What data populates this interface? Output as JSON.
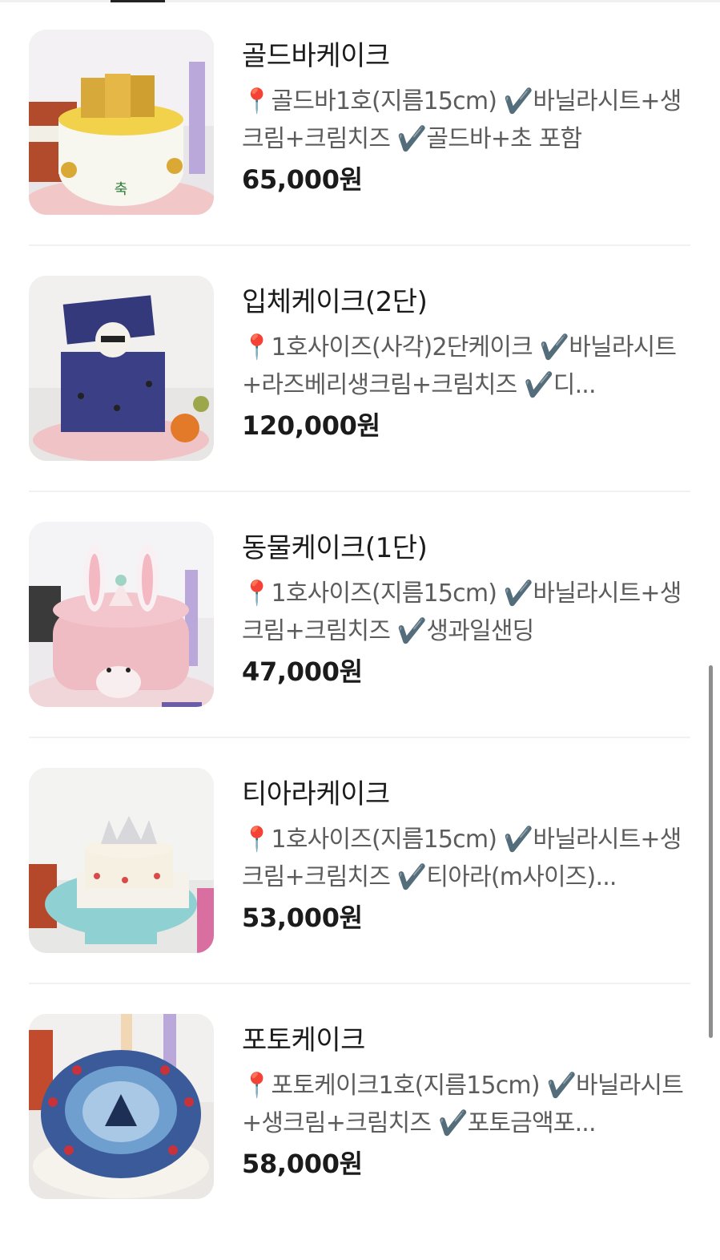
{
  "products": [
    {
      "name": "골드바케이크",
      "description": "📍골드바1호(지름15cm) ✔️바닐라시트+생크림+크림치즈 ✔️골드바+초 포함",
      "price": "65,000원",
      "image_icon": "gold-bar-cake-photo"
    },
    {
      "name": "입체케이크(2단)",
      "description": "📍1호사이즈(사각)2단케이크 ✔️바닐라시트+라즈베리생크림+크림치즈 ✔️디...",
      "price": "120,000원",
      "image_icon": "gift-box-cake-photo"
    },
    {
      "name": "동물케이크(1단)",
      "description": "📍1호사이즈(지름15cm) ✔️바닐라시트+생크림+크림치즈 ✔️생과일샌딩",
      "price": "47,000원",
      "image_icon": "bunny-cake-photo"
    },
    {
      "name": "티아라케이크",
      "description": "📍1호사이즈(지름15cm) ✔️바닐라시트+생크림+크림치즈 ✔️티아라(m사이즈)...",
      "price": "53,000원",
      "image_icon": "tiara-cake-photo"
    },
    {
      "name": "포토케이크",
      "description": "📍포토케이크1호(지름15cm) ✔️바닐라시트+생크림+크림치즈 ✔️포토금액포...",
      "price": "58,000원",
      "image_icon": "photo-cake-photo"
    }
  ],
  "colors": {
    "text": "#1b1b1b",
    "muted": "#5c5c5c",
    "divider": "#f1f1f1",
    "scrollbar": "#8e8e8e"
  }
}
